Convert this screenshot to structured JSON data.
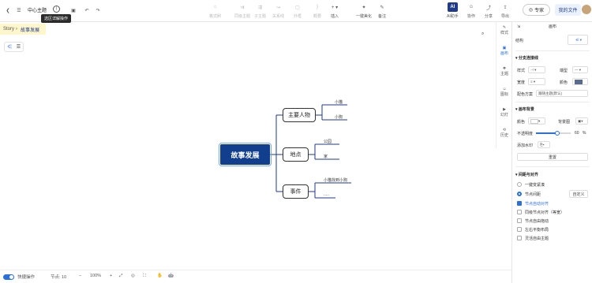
{
  "toolbar": {
    "doc_title": "中心主题",
    "tooltip": "选区详解操作",
    "items": {
      "format_painter": "格式刷",
      "same_level": "同级主题",
      "sub_topic": "子主题",
      "relation": "关系线",
      "outline": "外框",
      "summary": "概要",
      "insert": "插入",
      "beautify": "一键美化",
      "note": "备注",
      "ai": "AI",
      "ai_label": "AI助手",
      "collab": "协作",
      "share": "分享",
      "export": "导出"
    },
    "ai_panel_button": "专家",
    "my_files": "我的文件"
  },
  "breadcrumb": {
    "root": "Story",
    "current": "故事发展"
  },
  "mindmap": {
    "root": "故事发展",
    "branches": [
      {
        "label": "主要人物",
        "children": [
          "小猫",
          "小狗"
        ]
      },
      {
        "label": "地点",
        "children": [
          "公园",
          "家"
        ]
      },
      {
        "label": "事件",
        "children": [
          "小猫找到小狗",
          "....."
        ]
      }
    ]
  },
  "side_tabs": [
    "样式",
    "画布",
    "主题",
    "图标",
    "幻灯",
    "历史"
  ],
  "panel": {
    "title": "画布",
    "structure_label": "结构",
    "section_branch": "分支连接线",
    "style_label": "样式",
    "width_label": "宽度",
    "end_label": "端型",
    "color_label": "颜色",
    "color_scheme_label": "配色方案",
    "color_scheme_value": "跟随主题(默认)",
    "section_bg": "画布背景",
    "bg_color_label": "颜色",
    "bg_image_label": "背景图",
    "opacity_label": "不透明度",
    "opacity_value": "60",
    "opacity_unit": "%",
    "watermark_label": "添加水印",
    "reset_button": "重置",
    "section_layout": "间距与对齐",
    "radio_auto": "一键变紧凑",
    "radio_node": "节点间距",
    "custom_button": "自定义",
    "check_1": "节点自动对齐",
    "check_2": "同级节点对齐（等宽）",
    "check_3": "节点自由拖动",
    "check_4": "左右平衡布局",
    "check_5": "灵活自由主题"
  },
  "statusbar": {
    "quick_mode": "快捷操作",
    "node_count_label": "节点: 10",
    "zoom": "100%"
  },
  "colors": {
    "root_bg": "#123e8e",
    "accent": "#2a6fdb",
    "line": "#1f3b8a",
    "breadcrumb_bg": "#fff6cc"
  }
}
